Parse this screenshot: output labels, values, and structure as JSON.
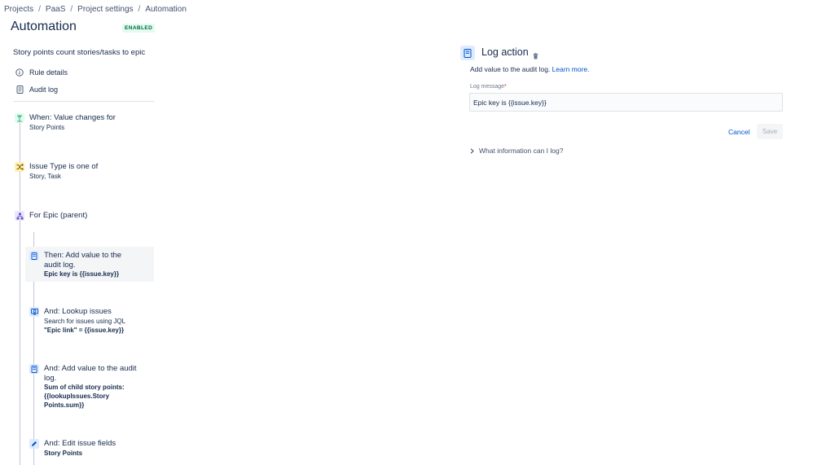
{
  "breadcrumb": [
    "Projects",
    "PaaS",
    "Project settings",
    "Automation"
  ],
  "breadcrumb_sep": "/",
  "page": {
    "title": "Automation",
    "status_badge": "ENABLED"
  },
  "rule": {
    "name": "Story points count stories/tasks to epic"
  },
  "sidebar": {
    "rule_details": "Rule details",
    "audit_log": "Audit log"
  },
  "components": {
    "trigger": {
      "title": "When: Value changes for",
      "sub": "Story Points",
      "icon": "trigger-icon",
      "color": "#36b37e"
    },
    "condition": {
      "title": "Issue Type is one of",
      "sub": "Story, Task",
      "icon": "shuffle-icon",
      "color": "#ffab00"
    },
    "branch": {
      "title": "For Epic (parent)",
      "icon": "hierarchy-icon",
      "color": "#6554c0"
    },
    "action1": {
      "title_line1": "Then: Add value to the",
      "title_line2": "audit log.",
      "detail": "Epic key is {{issue.key}}",
      "icon": "log-icon"
    },
    "action2": {
      "title": "And: Lookup issues",
      "sub": "Search for issues using JQL",
      "detail": "\"Epic link\" = {{issue.key}}",
      "icon": "lookup-icon"
    },
    "action3": {
      "title_line1": "And: Add value to the audit",
      "title_line2": "log.",
      "detail_line1": "Sum of child story points:",
      "detail_line2": "{{lookupIssues.Story",
      "detail_line3": "Points.sum}}",
      "icon": "log-icon"
    },
    "action4": {
      "title": "And: Edit issue fields",
      "detail": "Story Points",
      "icon": "pencil-icon"
    }
  },
  "panel": {
    "title": "Log action",
    "description": "Add value to the audit log.",
    "learn_more": "Learn more.",
    "field_label": "Log message",
    "required_mark": "*",
    "field_value": "Epic key is {{issue.key}}",
    "cancel": "Cancel",
    "save": "Save",
    "info_toggle": "What information can I log?"
  },
  "colors": {
    "accent": "#0052cc",
    "action_icon_bg": "#deebff",
    "enabled_green": "#006644"
  }
}
